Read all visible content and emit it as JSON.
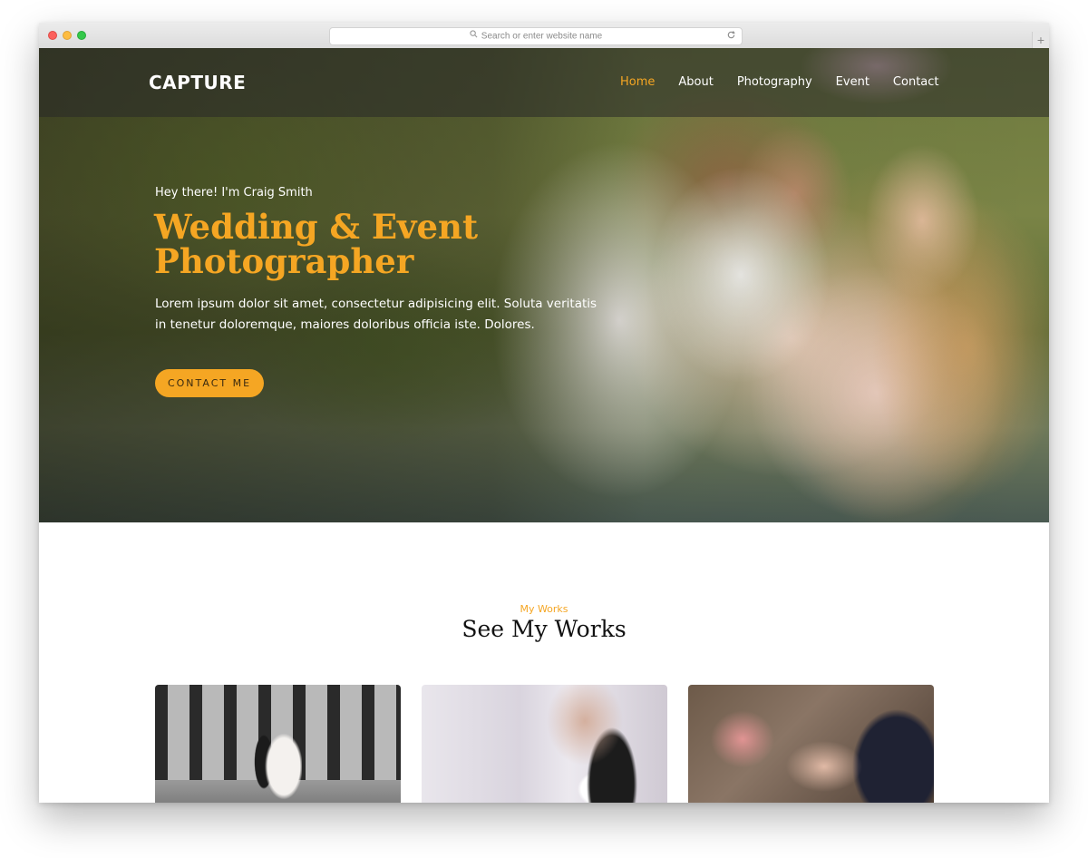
{
  "browser": {
    "address_placeholder": "Search or enter website name",
    "new_tab_label": "+"
  },
  "brand": {
    "logo": "CAPTURE"
  },
  "nav": {
    "items": [
      {
        "label": "Home",
        "active": true
      },
      {
        "label": "About",
        "active": false
      },
      {
        "label": "Photography",
        "active": false
      },
      {
        "label": "Event",
        "active": false
      },
      {
        "label": "Contact",
        "active": false
      }
    ]
  },
  "hero": {
    "greeting": "Hey there! I'm Craig Smith",
    "title": "Wedding & Event Photographer",
    "text": "Lorem ipsum dolor sit amet, consectetur adipisicing elit. Soluta veritatis in tenetur doloremque, maiores doloribus officia iste. Dolores.",
    "cta_label": "CONTACT ME"
  },
  "works": {
    "eyebrow": "My Works",
    "title": "See My Works"
  },
  "colors": {
    "accent": "#f5a623",
    "nav_bg": "rgba(40,40,40,0.55)",
    "title_text": "#111111"
  },
  "icons": {
    "search": "search-icon",
    "reload": "reload-icon",
    "close": "close-window-icon",
    "minimize": "minimize-window-icon",
    "maximize": "maximize-window-icon"
  }
}
